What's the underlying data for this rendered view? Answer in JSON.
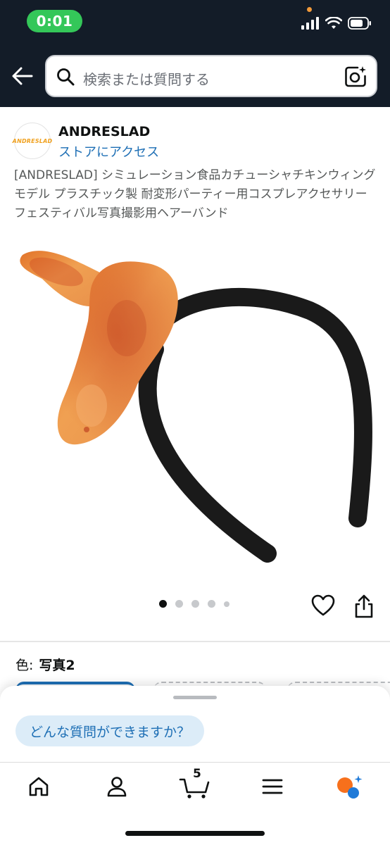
{
  "status_bar": {
    "time": "0:01"
  },
  "search": {
    "placeholder": "検索または質問する"
  },
  "store": {
    "logo_text": "ANDRESLAD",
    "name": "ANDRESLAD",
    "link": "ストアにアクセス"
  },
  "product": {
    "title": "[ANDRESLAD] シミュレーション食品カチューシャチキンウィングモデル プラスチック製 耐変形パーティー用コスプレアクセサリー フェスティバル写真撮影用ヘアーバンド",
    "image_count": 5,
    "active_image": 1
  },
  "variation": {
    "label": "色:",
    "value": "写真2"
  },
  "assistant": {
    "chip": "どんな質問ができますか？"
  },
  "nav": {
    "cart_count": "5"
  },
  "colors": {
    "topbar": "#131c28",
    "link": "#1e6fb5",
    "status_green": "#34c759"
  }
}
